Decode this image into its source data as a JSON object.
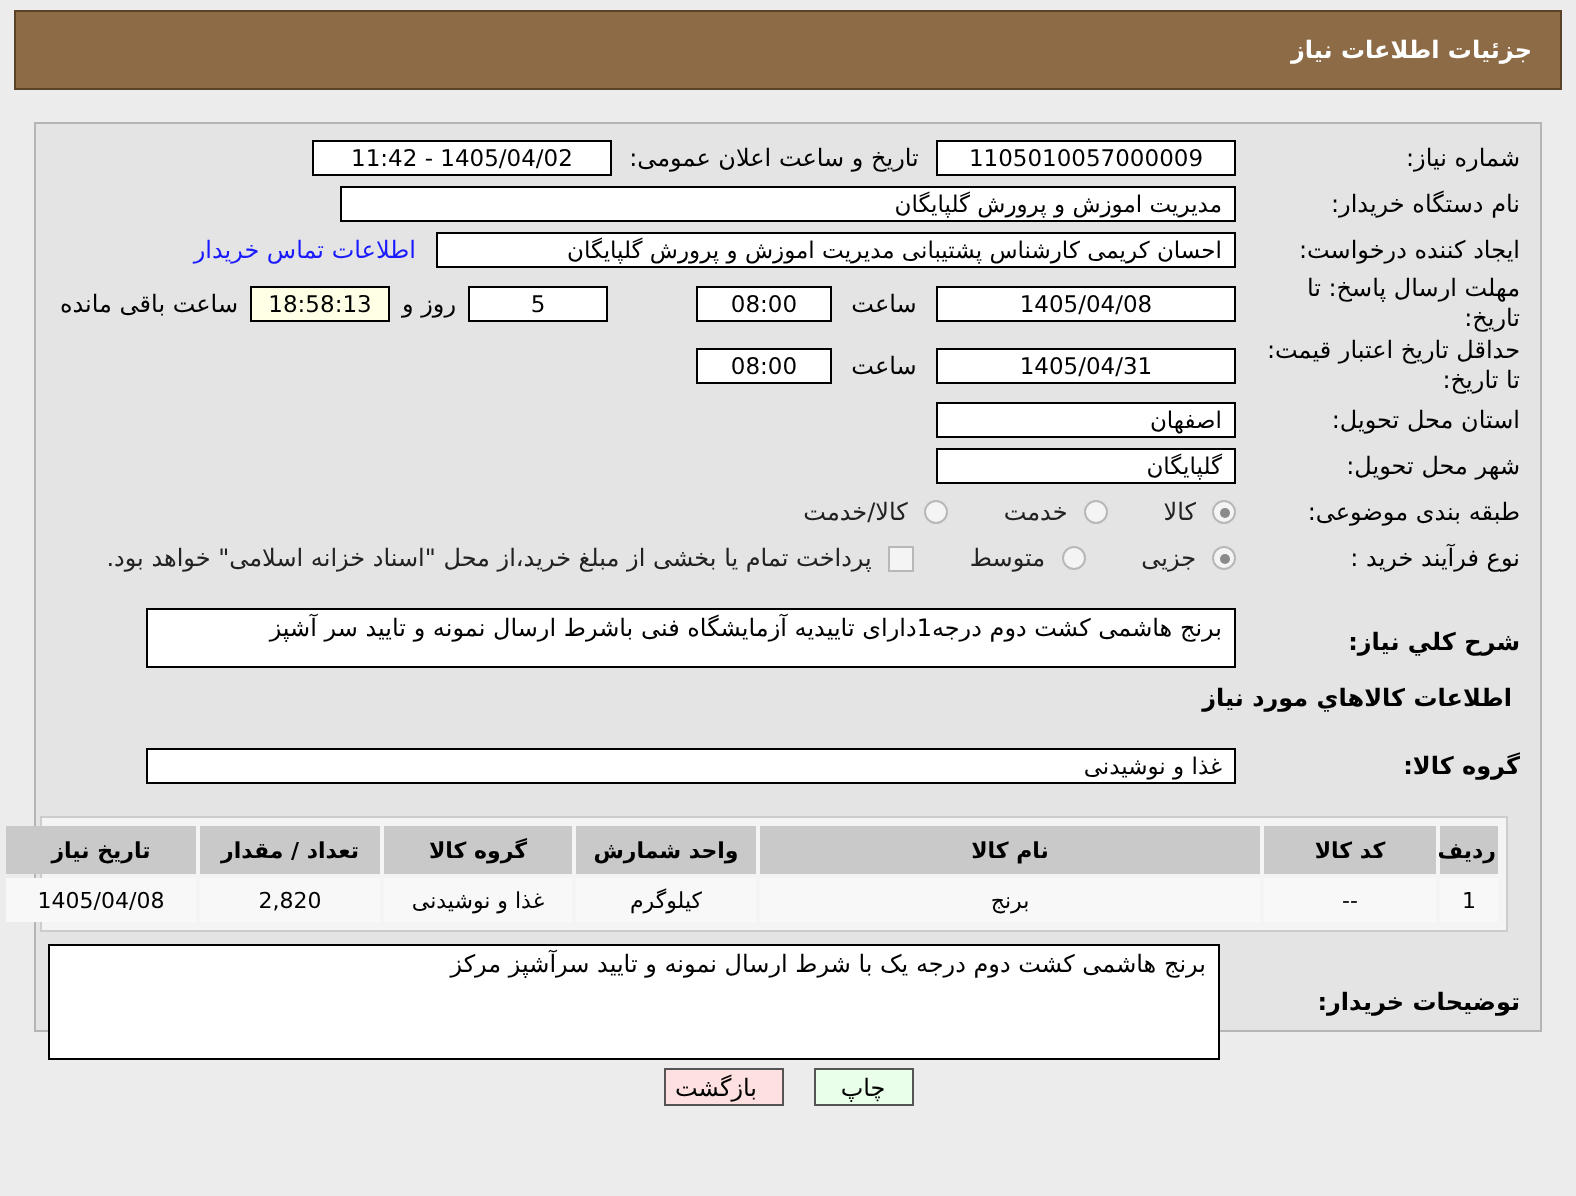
{
  "header": {
    "title": "جزئیات اطلاعات نیاز"
  },
  "need_number": {
    "label": "شماره نیاز:",
    "value": "1105010057000009"
  },
  "announce": {
    "label": "تاریخ و ساعت اعلان عمومی:",
    "value": "1405/04/02 - 11:42"
  },
  "buyer_org": {
    "label": "نام دستگاه خریدار:",
    "value": "مدیریت اموزش و پرورش گلپایگان"
  },
  "creator": {
    "label": "ایجاد کننده درخواست:",
    "value": "احسان کریمی کارشناس پشتیبانی مدیریت اموزش و پرورش گلپایگان",
    "link": "اطلاعات تماس خریدار"
  },
  "deadline": {
    "label": "مهلت ارسال پاسخ: تا تاریخ:",
    "date": "1405/04/08",
    "time_label": "ساعت",
    "time": "08:00",
    "days": "5",
    "days_label": "روز و",
    "remaining": "18:58:13",
    "remaining_label": "ساعت باقی مانده"
  },
  "validity": {
    "label": "حداقل تاریخ اعتبار قیمت: تا تاریخ:",
    "date": "1405/04/31",
    "time_label": "ساعت",
    "time": "08:00"
  },
  "province": {
    "label": "استان محل تحویل:",
    "value": "اصفهان"
  },
  "city": {
    "label": "شهر محل تحویل:",
    "value": "گلپایگان"
  },
  "category": {
    "label": "طبقه بندی موضوعی:",
    "options": [
      {
        "label": "کالا",
        "selected": true
      },
      {
        "label": "خدمت",
        "selected": false
      },
      {
        "label": "کالا/خدمت",
        "selected": false
      }
    ]
  },
  "process": {
    "label": "نوع فرآیند خرید :",
    "options": [
      {
        "label": "جزیی",
        "selected": true
      },
      {
        "label": "متوسط",
        "selected": false
      }
    ],
    "payment": {
      "label": "پرداخت تمام یا بخشی از مبلغ خرید،از محل \"اسناد خزانه اسلامی\" خواهد بود.",
      "checked": false
    }
  },
  "description": {
    "label": "شرح كلي نياز:",
    "value": "برنج هاشمی کشت دوم درجه1دارای تاییدیه آزمایشگاه فنی باشرط ارسال نمونه و تایید سر آشپز"
  },
  "goods_title": "اطلاعات كالاهاي مورد نياز",
  "goods_group": {
    "label": "گروه کالا:",
    "value": "غذا و نوشیدنی"
  },
  "table": {
    "columns": [
      "ردیف",
      "کد کالا",
      "نام کالا",
      "واحد شمارش",
      "گروه کالا",
      "تعداد / مقدار",
      "تاریخ نیاز"
    ],
    "rows": [
      [
        "1",
        "--",
        "برنج",
        "کیلوگرم",
        "غذا و نوشیدنی",
        "2,820",
        "1405/04/08"
      ]
    ]
  },
  "buyer_notes": {
    "label": "توضیحات خریدار:",
    "value": "برنج هاشمی کشت دوم درجه یک با شرط ارسال نمونه و تایید سرآشپز مرکز"
  },
  "buttons": [
    {
      "label": "چاپ",
      "kind": "print"
    },
    {
      "label": "بازگشت",
      "kind": "back"
    }
  ]
}
